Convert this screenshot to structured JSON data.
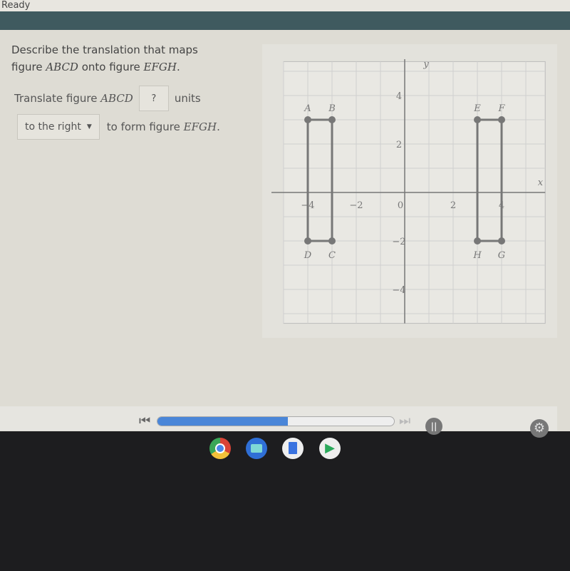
{
  "status_text": "Ready",
  "question": {
    "line1": "Describe the translation that maps",
    "line2_pre": "figure ",
    "fig1": "ABCD",
    "line2_mid": " onto figure ",
    "fig2": "EFGH",
    "line2_end": "."
  },
  "step": {
    "pre": "Translate figure ",
    "fig": "ABCD",
    "answer": "?",
    "units": "units",
    "direction": "to the right",
    "post": "to form figure ",
    "fig2": "EFGH",
    "end": "."
  },
  "chart_data": {
    "type": "scatter",
    "xlabel": "x",
    "ylabel": "y",
    "xlim": [
      -5.5,
      5.5
    ],
    "ylim": [
      -5,
      5
    ],
    "grid": true,
    "x_ticks": [
      "−4",
      "−2",
      "0",
      "2",
      "4"
    ],
    "y_ticks": [
      "4",
      "2",
      "−2",
      "−4"
    ],
    "figures": [
      {
        "name": "ABCD",
        "points": [
          {
            "label": "A",
            "x": -4,
            "y": 3
          },
          {
            "label": "B",
            "x": -3,
            "y": 3
          },
          {
            "label": "C",
            "x": -3,
            "y": -2
          },
          {
            "label": "D",
            "x": -4,
            "y": -2
          }
        ]
      },
      {
        "name": "EFGH",
        "points": [
          {
            "label": "E",
            "x": 3,
            "y": 3
          },
          {
            "label": "F",
            "x": 4,
            "y": 3
          },
          {
            "label": "G",
            "x": 4,
            "y": -2
          },
          {
            "label": "H",
            "x": 3,
            "y": -2
          }
        ]
      }
    ]
  },
  "player": {
    "progress_percent": 55
  },
  "colors": {
    "band": "#3f5a5f",
    "progress": "#4a86d8"
  },
  "shelf": [
    "chrome-icon",
    "files-icon",
    "docs-icon",
    "play-store-icon"
  ]
}
